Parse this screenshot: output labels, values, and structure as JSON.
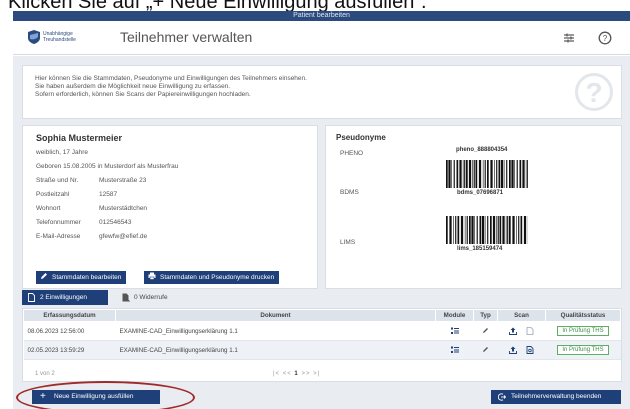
{
  "caption": "Klicken Sie auf „+ Neue Einwilligung ausfüllen“.",
  "window_title": "Patient bearbeiten",
  "header": {
    "logo_text": "Unabhängige Treuhandstelle",
    "title": "Teilnehmer verwalten"
  },
  "info": {
    "line1": "Hier können Sie die Stammdaten, Pseudonyme und Einwilligungen des Teilnehmers einsehen.",
    "line2": "Sie haben außerdem die Möglichkeit neue Einwilligung zu erfassen.",
    "line3": "Sofern erforderlich, können Sie Scans der Papiereinwilligungen hochladen."
  },
  "person": {
    "name": "Sophia Mustermeier",
    "gender_age": "weiblich, 17 Jahre",
    "birth": "Geboren 15.08.2005 in Musterdorf als Musterfrau",
    "fields": [
      {
        "label": "Straße und Nr.",
        "value": "Musterstraße 23"
      },
      {
        "label": "Postleitzahl",
        "value": "12587"
      },
      {
        "label": "Wohnort",
        "value": "Musterstädtchen"
      },
      {
        "label": "Telefonnummer",
        "value": "012546543"
      },
      {
        "label": "E-Mail-Adresse",
        "value": "gfewfw@efief.de"
      }
    ],
    "edit_button": "Stammdaten bearbeiten",
    "print_button": "Stammdaten und Pseudonyme drucken"
  },
  "pseudonyms": {
    "title": "Pseudonyme",
    "items": [
      {
        "label": "PHENO",
        "value": "pheno_888804354"
      },
      {
        "label": "BDMS",
        "value": "bdms_07696871"
      },
      {
        "label": "LIMS",
        "value": "lims_185159474"
      }
    ]
  },
  "tabs": [
    {
      "label": "2 Einwilligungen",
      "icon": "file-icon"
    },
    {
      "label": "0 Widerrufe",
      "icon": "file-strike-icon"
    }
  ],
  "table": {
    "headers": [
      "Erfassungsdatum",
      "Dokument",
      "Module",
      "Typ",
      "Scan",
      "Qualitätsstatus"
    ],
    "rows": [
      {
        "date": "08.06.2023 12:56:00",
        "document": "EXAMINE-CAD_Einwilligungserklärung 1.1",
        "status": "In Prüfung THS"
      },
      {
        "date": "02.05.2023 13:59:29",
        "document": "EXAMINE-CAD_Einwilligungserklärung 1.1",
        "status": "In Prüfung THS"
      }
    ],
    "pager_count": "1 von 2",
    "pager_nav_prev": "|< <<",
    "pager_current": "1",
    "pager_nav_next": ">> >|"
  },
  "buttons": {
    "new_consent": "Neue Einwilligung ausfüllen",
    "end": "Teilnehmerverwaltung beenden"
  },
  "colors": {
    "primary": "#1f3f78",
    "status_green": "#3f8b48",
    "highlight_oval": "#a12b2b"
  }
}
